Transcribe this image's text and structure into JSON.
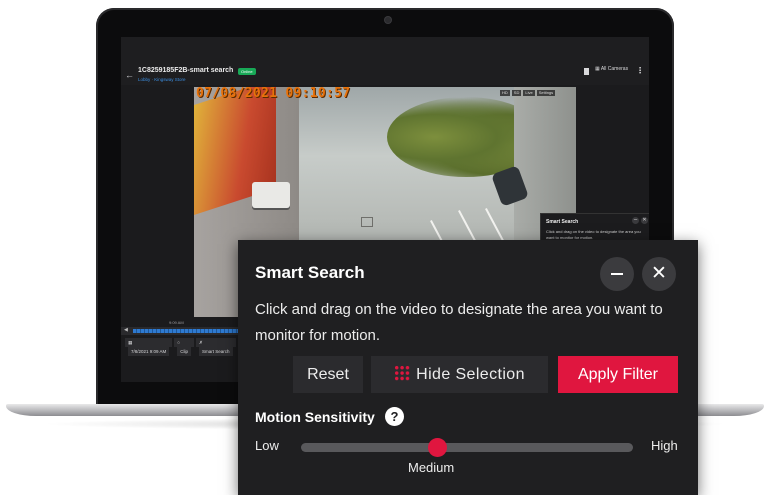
{
  "camera": {
    "title": "1C8259185F2B-smart search",
    "status_badge": "Online",
    "location": "Lobby · Kingsway Store",
    "all_cameras_label": "All Cameras"
  },
  "video": {
    "timestamp": "07/08/2021 09:10:57",
    "controls": [
      "HD",
      "SD",
      "Live",
      "Settings"
    ]
  },
  "mini_panel": {
    "title": "Smart Search",
    "description": "Click and drag on the video to designate the area you want to monitor for motion."
  },
  "timeline": {
    "current_time": "9:09 AM",
    "date_button": "7/8/2021 9:09 AM",
    "clip_button": "Clip",
    "smart_search_button": "Smart Search"
  },
  "smart_search": {
    "title": "Smart Search",
    "description": "Click and drag on the video to designate the area you want to monitor for motion.",
    "reset_label": "Reset",
    "hide_selection_label": "Hide Selection",
    "apply_filter_label": "Apply Filter",
    "sensitivity_label": "Motion Sensitivity",
    "help_icon_glyph": "?",
    "low_label": "Low",
    "high_label": "High",
    "current_level_label": "Medium",
    "sensitivity_value": 0.41
  },
  "colors": {
    "accent": "#e0163f",
    "panel_bg": "#1f1f21",
    "timestamp": "#e8720a",
    "online": "#18a957"
  },
  "icons": {
    "minimize": "minus-icon",
    "close": "close-icon",
    "hide_selection": "grid-dots-icon",
    "help": "question-circle-icon"
  }
}
